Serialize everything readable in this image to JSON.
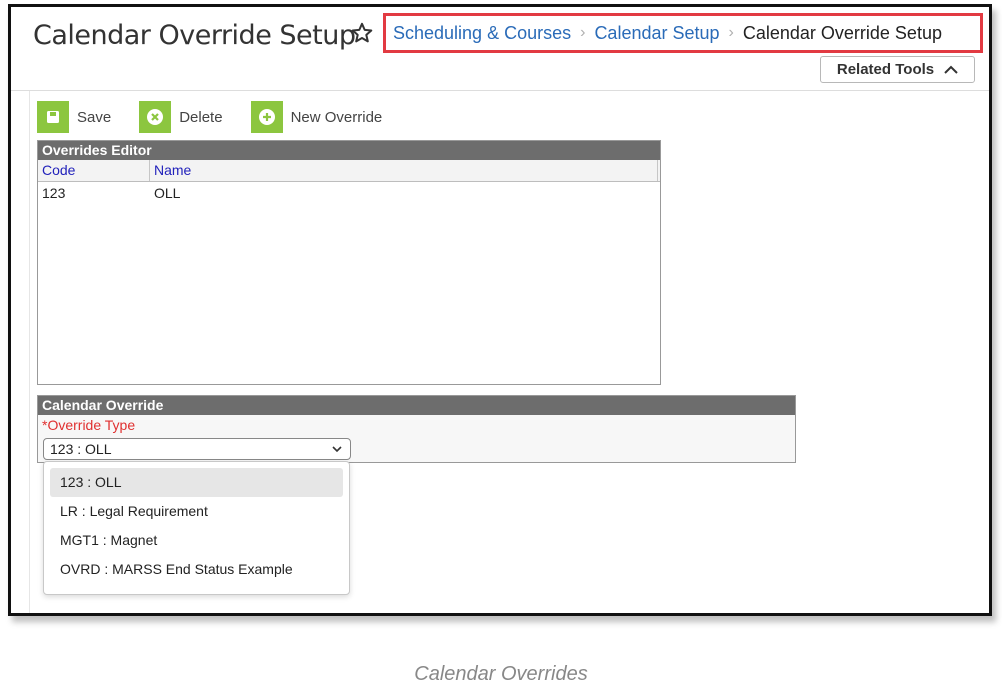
{
  "header": {
    "title": "Calendar Override Setup",
    "breadcrumb": {
      "links": [
        "Scheduling & Courses",
        "Calendar Setup"
      ],
      "current": "Calendar Override Setup"
    },
    "related_tools_label": "Related Tools"
  },
  "toolbar": {
    "save_label": "Save",
    "delete_label": "Delete",
    "new_override_label": "New Override"
  },
  "overrides_editor": {
    "title": "Overrides Editor",
    "columns": [
      "Code",
      "Name"
    ],
    "rows": [
      {
        "code": "123",
        "name": "OLL"
      }
    ]
  },
  "calendar_override": {
    "title": "Calendar Override",
    "override_type_label": "*Override Type",
    "override_type_value": "123 : OLL",
    "options": [
      "123 : OLL",
      "LR : Legal Requirement",
      "MGT1 : Magnet",
      "OVRD : MARSS End Status Example"
    ]
  },
  "caption": "Calendar Overrides",
  "colors": {
    "breadcrumb_highlight": "#e23a42",
    "toolbar_icon": "#8cc63f",
    "section_header": "#6d6d6d",
    "link": "#2a6bb8",
    "required_label": "#e03030"
  },
  "icons": [
    "star-icon",
    "chevron-up-icon",
    "save-icon",
    "delete-icon",
    "add-icon",
    "chevron-down-icon",
    "breadcrumb-separator-icon"
  ]
}
